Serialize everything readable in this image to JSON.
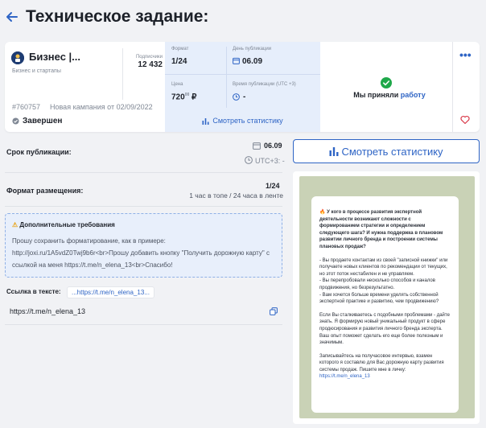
{
  "header": {
    "title": "Техническое задание:"
  },
  "channel": {
    "name": "Бизнес |...",
    "category": "Бизнес и стартапы",
    "subscribers_label": "Подписчики",
    "subscribers": "12 432",
    "campaign_id": "#760757",
    "campaign_name": "Новая кампания от 02/09/2022",
    "status": "Завершен"
  },
  "placement": {
    "format_label": "Формат",
    "format_value": "1/24",
    "date_label": "День публикации",
    "date_value": "06.09",
    "price_label": "Цена",
    "price_value": "720",
    "price_kop": "00",
    "price_currency": "₽",
    "time_label": "Время публикации (UTC +3)",
    "time_value": "-",
    "stats_label": "Смотреть статистику"
  },
  "accepted": {
    "text": "Мы приняли ",
    "link": "работу"
  },
  "details": {
    "publish_term_label": "Срок публикации:",
    "publish_date": "06.09",
    "publish_tz": "UTC+3: -",
    "format_label": "Формат размещения:",
    "format_value": "1/24",
    "format_desc": "1 час в топе / 24 часа в ленте",
    "requirements_title": "Дополнительные требования",
    "requirements_text": "Прошу сохранить форматирование, как в примере: http://joxi.ru/1A5vdZ0Twj9b6r<br>Прошу добавить кнопку \"Получить дорожную карту\" с ссылкой на меня https://t.me/n_elena_13<br>Спасибо!",
    "link_label": "Ссылка в тексте:",
    "link_short": "...https://t.me/n_elena_13...",
    "link_full": "https://t.me/n_elena_13"
  },
  "right": {
    "stats_button": "Смотреть статистику"
  },
  "post": {
    "p1": "У кого в процессе развития экспертной деятельности возникают сложности с формированием стратегии и определением следующего шага? И нужна поддержка в плановом развитии личного бренда и построении системы плановых продаж?",
    "p2": "- Вы продаете контактам из своей \"записной книжки\" или получаете новых клиентов по рекомендации от текущих, но этот поток нестабилен и не управляем.",
    "p3": "- Вы перепробовали несколько способов и каналов продвижения, но безрезультатно.",
    "p4": "- Вам хочется больше времени уделять собственной экспертной практике и развитию, чем продвижению?",
    "p5": "Если Вы сталкиваетесь с подобными проблемами - дайте знать. Я формирую новый уникальный продукт в сфере продюсирования и развития личного бренда эксперта. Ваш опыт поможет сделать его еще более полезным и значимым.",
    "p6": "Записывайтесь на получасовое интервью, взамен которого я составлю для Вас дорожную карту развития системы продаж. Пишите мне в личку:",
    "link": "https://t.me/n_elena_13"
  },
  "colors": {
    "accent": "#2e64c5",
    "success": "#1fa84a",
    "danger": "#d93a4a",
    "panel": "#e6eefb"
  }
}
